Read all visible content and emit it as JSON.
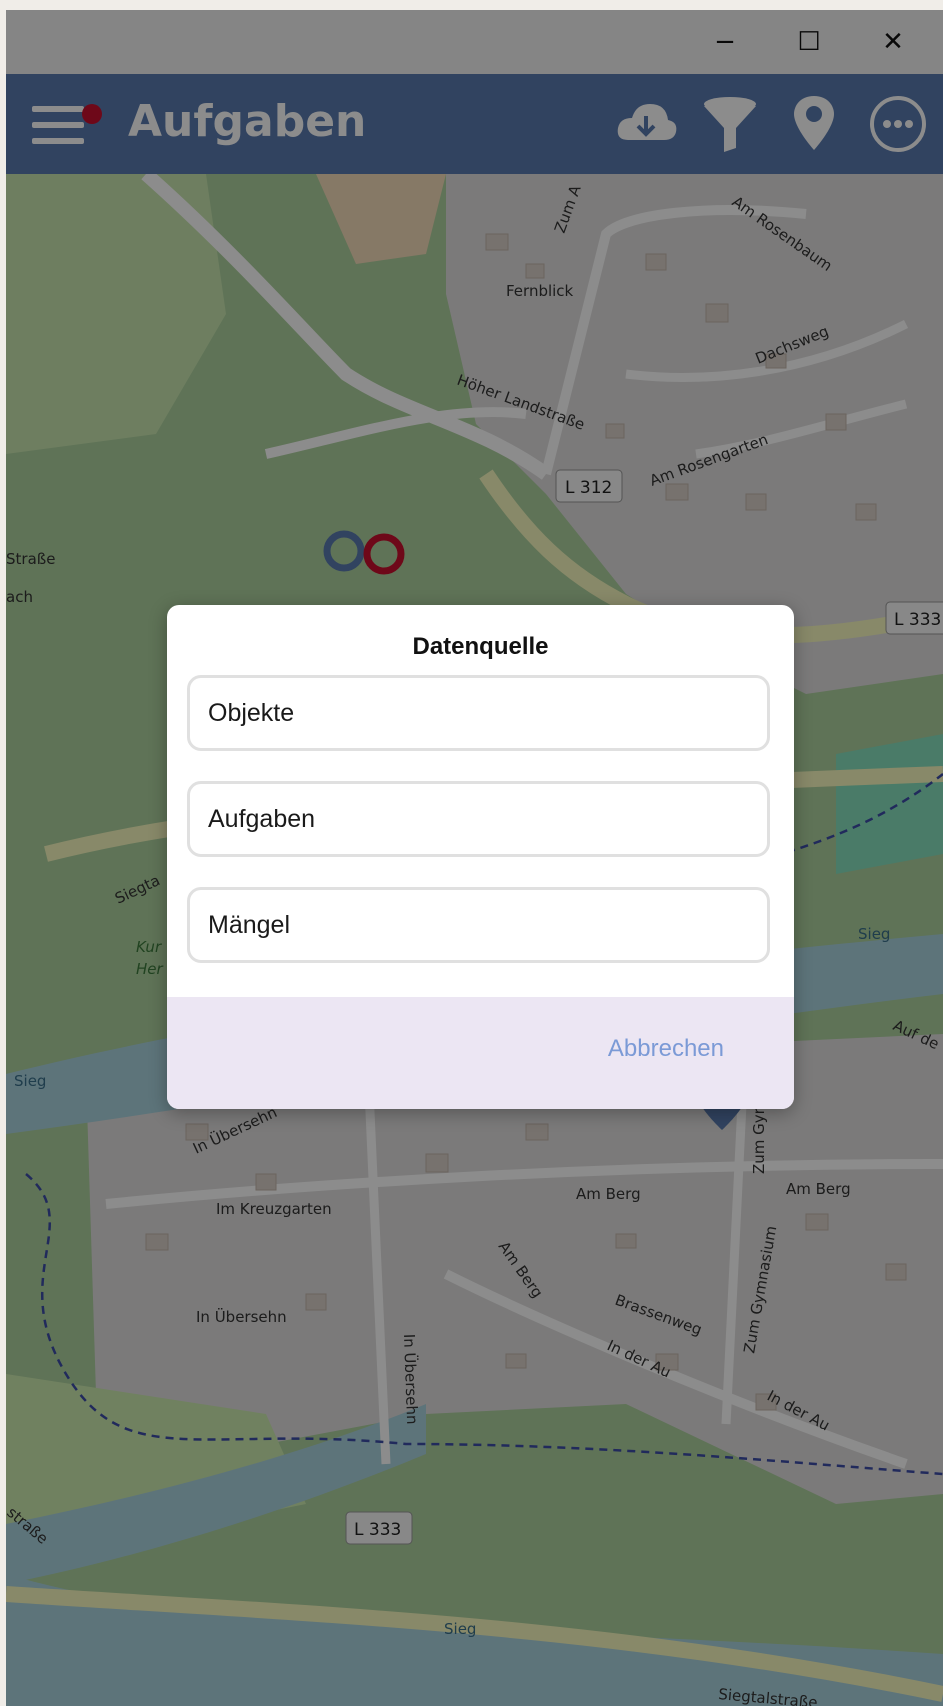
{
  "window": {
    "minimize_glyph": "−",
    "maximize_glyph": "☐",
    "close_glyph": "✕"
  },
  "appbar": {
    "title": "Aufgaben",
    "accent": "#5a7bb0",
    "notification_dot_color": "#c8102e",
    "icons": [
      "menu-icon",
      "cloud-download-icon",
      "filter-icon",
      "location-pin-icon",
      "more-icon"
    ]
  },
  "map": {
    "labels": {
      "fernblick": "Fernblick",
      "am_rosenbaum": "Am Rosenbaum",
      "dachsweg": "Dachsweg",
      "hoher_landstrasse": "Höher Landstraße",
      "am_rosengarten": "Am Rosengarten",
      "l312": "L 312",
      "l333_top": "L 333",
      "zum_a": "Zum A",
      "strasse_left": "Straße",
      "ach_left": "ach",
      "siegta": "Siegta",
      "sieg_left": "Sieg",
      "sieg_right": "Sieg",
      "sieg_bottom": "Sieg",
      "auf_de": "Auf de",
      "in_uebersehn_1": "In Übersehn",
      "im_kreuzgarten": "Im Kreuzgarten",
      "am_berg_1": "Am Berg",
      "am_berg_2": "Am Berg",
      "am_berg_3": "Am Berg",
      "zum_gymnasium_1": "Zum Gymnasium",
      "zum_gymnasium_2": "Zum Gymnasium",
      "brassenweg": "Brassenweg",
      "in_der_au_1": "In der Au",
      "in_der_au_2": "In der Au",
      "in_uebersehn_2": "In Übersehn",
      "in_uebersehn_3": "In Übersehn",
      "strasse_bottom": "straße",
      "l333_bottom": "L 333",
      "siegtalstrasse": "Siegtalstraße",
      "kur": "Kur",
      "her": "Her"
    }
  },
  "dialog": {
    "title": "Datenquelle",
    "options": [
      "Objekte",
      "Aufgaben",
      "Mängel"
    ],
    "cancel_label": "Abbrechen"
  }
}
